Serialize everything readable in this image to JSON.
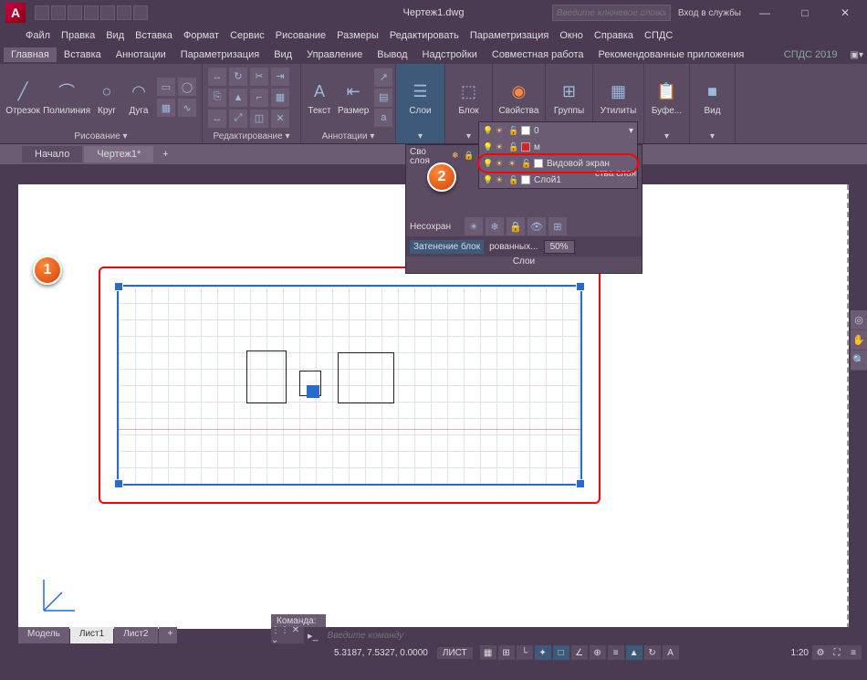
{
  "title": "Чертеж1.dwg",
  "search_placeholder": "Введите ключевое слово/фразу",
  "signin": "Вход в службы",
  "menus": [
    "Файл",
    "Правка",
    "Вид",
    "Вставка",
    "Формат",
    "Сервис",
    "Рисование",
    "Размеры",
    "Редактировать",
    "Параметризация",
    "Окно",
    "Справка",
    "СПДС"
  ],
  "ribbon_tabs": [
    "Главная",
    "Вставка",
    "Аннотации",
    "Параметризация",
    "Вид",
    "Управление",
    "Вывод",
    "Надстройки",
    "Совместная работа",
    "Рекомендованные приложения"
  ],
  "ribbon_tab_right": "СПДС 2019",
  "panels": {
    "draw": {
      "title": "Рисование ▾",
      "tools": [
        {
          "l": "Отрезок"
        },
        {
          "l": "Полилиния"
        },
        {
          "l": "Круг"
        },
        {
          "l": "Дуга"
        }
      ]
    },
    "modify": {
      "title": "Редактирование ▾"
    },
    "annot": {
      "title": "Аннотации ▾",
      "tools": [
        {
          "l": "Текст"
        },
        {
          "l": "Размер"
        }
      ]
    },
    "layers": {
      "title": "Слои",
      "tool": "Слои"
    },
    "block": {
      "title": "Блок",
      "tool": "Блок"
    },
    "props": {
      "title": "Свойства",
      "tool": "Свойства"
    },
    "groups": {
      "title": "Группы",
      "tool": "Группы"
    },
    "utils": {
      "title": "Утилиты",
      "tool": "Утилиты"
    },
    "clip": {
      "title": "Буфе...",
      "tool": "Буфе..."
    },
    "view": {
      "title": "Вид",
      "tool": "Вид"
    }
  },
  "doc_tabs": [
    "Начало",
    "Чертеж1*"
  ],
  "layer_flyout": {
    "left1": "Сво\nслоя",
    "left2": "Несохран",
    "layers": [
      {
        "name": "0",
        "color": "#fff"
      },
      {
        "name": "м",
        "color": "#d22"
      },
      {
        "name": "Видовой экран",
        "color": "#fff",
        "highlight": true
      },
      {
        "name": "Слой1",
        "color": "#fff"
      }
    ],
    "right_label": "ства слоя",
    "shade_btn": "Затенение блок",
    "shade_mid": "рованных...",
    "shade_val": "50%",
    "panel_title": "Слои"
  },
  "pins": {
    "p1": "1",
    "p2": "2"
  },
  "cmd_hist": "Команда:",
  "cmd_placeholder": "Введите команду",
  "bottom_tabs": [
    "Модель",
    "Лист1",
    "Лист2"
  ],
  "status": {
    "coords": "5.3187, 7.5327, 0.0000",
    "space": "ЛИСТ",
    "scale": "1:20"
  }
}
